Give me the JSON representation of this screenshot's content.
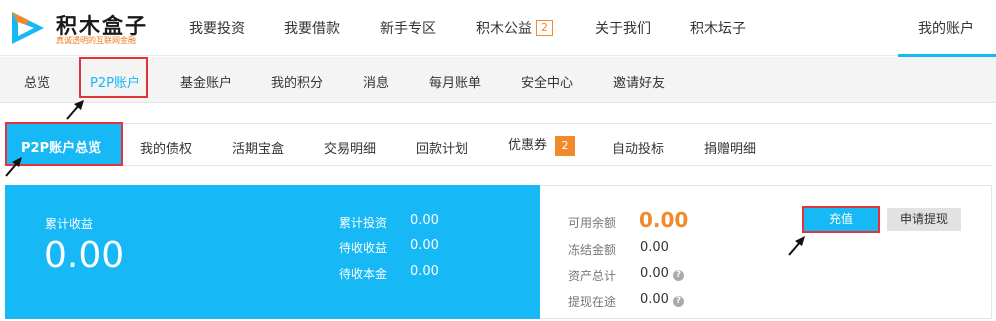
{
  "brand": {
    "name": "积木盒子",
    "slogan": "真诚透明的互联网金融",
    "accent": "#16b8f5",
    "orange": "#f08a2c",
    "highlight": "#e0333a"
  },
  "topnav": {
    "items": [
      {
        "label": "我要投资"
      },
      {
        "label": "我要借款"
      },
      {
        "label": "新手专区"
      },
      {
        "label": "积木公益",
        "badge": "2"
      },
      {
        "label": "关于我们"
      },
      {
        "label": "积木坛子"
      }
    ],
    "account_label": "我的账户"
  },
  "subnav": {
    "items": [
      {
        "label": "总览"
      },
      {
        "label": "P2P账户",
        "active": true
      },
      {
        "label": "基金账户"
      },
      {
        "label": "我的积分"
      },
      {
        "label": "消息"
      },
      {
        "label": "每月账单"
      },
      {
        "label": "安全中心"
      },
      {
        "label": "邀请好友"
      }
    ]
  },
  "tabs": {
    "items": [
      {
        "label": "P2P账户总览",
        "active": true
      },
      {
        "label": "我的债权"
      },
      {
        "label": "活期宝盒"
      },
      {
        "label": "交易明细"
      },
      {
        "label": "回款计划"
      },
      {
        "label": "优惠券",
        "badge": "2"
      },
      {
        "label": "自动投标"
      },
      {
        "label": "捐赠明细"
      }
    ]
  },
  "summary": {
    "earnings_label": "累计收益",
    "earnings_value": "0.00",
    "stats": [
      {
        "label": "累计投资",
        "value": "0.00"
      },
      {
        "label": "待收收益",
        "value": "0.00"
      },
      {
        "label": "待收本金",
        "value": "0.00"
      }
    ]
  },
  "balance": {
    "available_label": "可用余额",
    "available_value": "0.00",
    "rows": [
      {
        "label": "冻结金额",
        "value": "0.00",
        "help": false
      },
      {
        "label": "资产总计",
        "value": "0.00",
        "help": true
      },
      {
        "label": "提现在途",
        "value": "0.00",
        "help": true
      }
    ],
    "recharge_label": "充值",
    "withdraw_label": "申请提现"
  }
}
